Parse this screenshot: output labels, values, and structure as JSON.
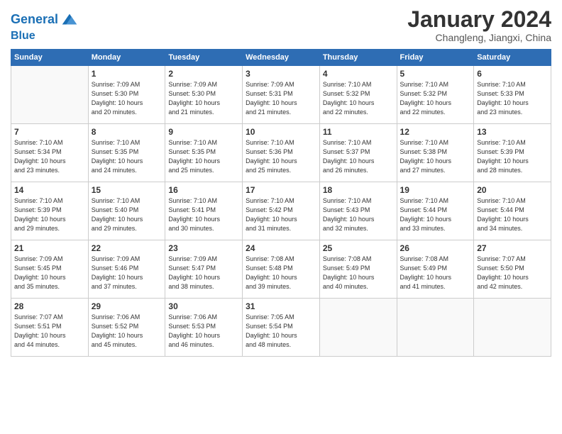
{
  "logo": {
    "line1": "General",
    "line2": "Blue"
  },
  "title": "January 2024",
  "subtitle": "Changleng, Jiangxi, China",
  "headers": [
    "Sunday",
    "Monday",
    "Tuesday",
    "Wednesday",
    "Thursday",
    "Friday",
    "Saturday"
  ],
  "weeks": [
    [
      {
        "day": "",
        "info": ""
      },
      {
        "day": "1",
        "info": "Sunrise: 7:09 AM\nSunset: 5:30 PM\nDaylight: 10 hours\nand 20 minutes."
      },
      {
        "day": "2",
        "info": "Sunrise: 7:09 AM\nSunset: 5:30 PM\nDaylight: 10 hours\nand 21 minutes."
      },
      {
        "day": "3",
        "info": "Sunrise: 7:09 AM\nSunset: 5:31 PM\nDaylight: 10 hours\nand 21 minutes."
      },
      {
        "day": "4",
        "info": "Sunrise: 7:10 AM\nSunset: 5:32 PM\nDaylight: 10 hours\nand 22 minutes."
      },
      {
        "day": "5",
        "info": "Sunrise: 7:10 AM\nSunset: 5:32 PM\nDaylight: 10 hours\nand 22 minutes."
      },
      {
        "day": "6",
        "info": "Sunrise: 7:10 AM\nSunset: 5:33 PM\nDaylight: 10 hours\nand 23 minutes."
      }
    ],
    [
      {
        "day": "7",
        "info": "Sunrise: 7:10 AM\nSunset: 5:34 PM\nDaylight: 10 hours\nand 23 minutes."
      },
      {
        "day": "8",
        "info": "Sunrise: 7:10 AM\nSunset: 5:35 PM\nDaylight: 10 hours\nand 24 minutes."
      },
      {
        "day": "9",
        "info": "Sunrise: 7:10 AM\nSunset: 5:35 PM\nDaylight: 10 hours\nand 25 minutes."
      },
      {
        "day": "10",
        "info": "Sunrise: 7:10 AM\nSunset: 5:36 PM\nDaylight: 10 hours\nand 25 minutes."
      },
      {
        "day": "11",
        "info": "Sunrise: 7:10 AM\nSunset: 5:37 PM\nDaylight: 10 hours\nand 26 minutes."
      },
      {
        "day": "12",
        "info": "Sunrise: 7:10 AM\nSunset: 5:38 PM\nDaylight: 10 hours\nand 27 minutes."
      },
      {
        "day": "13",
        "info": "Sunrise: 7:10 AM\nSunset: 5:39 PM\nDaylight: 10 hours\nand 28 minutes."
      }
    ],
    [
      {
        "day": "14",
        "info": "Sunrise: 7:10 AM\nSunset: 5:39 PM\nDaylight: 10 hours\nand 29 minutes."
      },
      {
        "day": "15",
        "info": "Sunrise: 7:10 AM\nSunset: 5:40 PM\nDaylight: 10 hours\nand 29 minutes."
      },
      {
        "day": "16",
        "info": "Sunrise: 7:10 AM\nSunset: 5:41 PM\nDaylight: 10 hours\nand 30 minutes."
      },
      {
        "day": "17",
        "info": "Sunrise: 7:10 AM\nSunset: 5:42 PM\nDaylight: 10 hours\nand 31 minutes."
      },
      {
        "day": "18",
        "info": "Sunrise: 7:10 AM\nSunset: 5:43 PM\nDaylight: 10 hours\nand 32 minutes."
      },
      {
        "day": "19",
        "info": "Sunrise: 7:10 AM\nSunset: 5:44 PM\nDaylight: 10 hours\nand 33 minutes."
      },
      {
        "day": "20",
        "info": "Sunrise: 7:10 AM\nSunset: 5:44 PM\nDaylight: 10 hours\nand 34 minutes."
      }
    ],
    [
      {
        "day": "21",
        "info": "Sunrise: 7:09 AM\nSunset: 5:45 PM\nDaylight: 10 hours\nand 35 minutes."
      },
      {
        "day": "22",
        "info": "Sunrise: 7:09 AM\nSunset: 5:46 PM\nDaylight: 10 hours\nand 37 minutes."
      },
      {
        "day": "23",
        "info": "Sunrise: 7:09 AM\nSunset: 5:47 PM\nDaylight: 10 hours\nand 38 minutes."
      },
      {
        "day": "24",
        "info": "Sunrise: 7:08 AM\nSunset: 5:48 PM\nDaylight: 10 hours\nand 39 minutes."
      },
      {
        "day": "25",
        "info": "Sunrise: 7:08 AM\nSunset: 5:49 PM\nDaylight: 10 hours\nand 40 minutes."
      },
      {
        "day": "26",
        "info": "Sunrise: 7:08 AM\nSunset: 5:49 PM\nDaylight: 10 hours\nand 41 minutes."
      },
      {
        "day": "27",
        "info": "Sunrise: 7:07 AM\nSunset: 5:50 PM\nDaylight: 10 hours\nand 42 minutes."
      }
    ],
    [
      {
        "day": "28",
        "info": "Sunrise: 7:07 AM\nSunset: 5:51 PM\nDaylight: 10 hours\nand 44 minutes."
      },
      {
        "day": "29",
        "info": "Sunrise: 7:06 AM\nSunset: 5:52 PM\nDaylight: 10 hours\nand 45 minutes."
      },
      {
        "day": "30",
        "info": "Sunrise: 7:06 AM\nSunset: 5:53 PM\nDaylight: 10 hours\nand 46 minutes."
      },
      {
        "day": "31",
        "info": "Sunrise: 7:05 AM\nSunset: 5:54 PM\nDaylight: 10 hours\nand 48 minutes."
      },
      {
        "day": "",
        "info": ""
      },
      {
        "day": "",
        "info": ""
      },
      {
        "day": "",
        "info": ""
      }
    ]
  ]
}
